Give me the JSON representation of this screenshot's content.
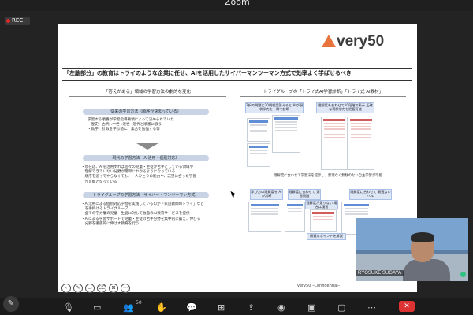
{
  "meeting": {
    "title": "Zoom",
    "rec_label": "REC"
  },
  "slide": {
    "logo_text": "very50",
    "title": "「左脳部分」の教育はトライのような企業に任せ、AIを活用したサイバーマンツーマン方式で効率よく学ばせるべき",
    "left": {
      "heading": "「答えがある」領域の学習方法の劇的な変化",
      "old_label": "従来の学習方法（順序が決まっている）",
      "old_bullets": [
        "学習する順番が学習指導要領によって決められていた",
        "・歴史：古代→中世→近世→近代と順番に扱う",
        "・数学：計数を学ぶ前に、集合を勉強する等"
      ],
      "now_label": "現代の学習方法（AI活用・個別対応）",
      "now_bullets": [
        "・現在は、AIを活用すれば個々の児童・生徒が苦手としている領域や",
        "　理解できていない分野が簡単にわかるようになっている",
        "・順序を追ってやらなくても、一人ひとりの能力や、志望に合った学習",
        "　が可能となっている"
      ],
      "try_label": "トライグループの学習方法（サイバー・マンツーマン方式）",
      "try_bullets": [
        "・AI活用による個別対応学習を実践しているのが「家庭教師のトライ」など",
        "　を手掛けるトライグループ",
        "・全ての学力層の児童・生徒に対して独自のAI教育サービスを提供",
        "・AIによる学習サポートで児童・生徒の苦手分野を集中的に鍛え、伸びる",
        "　分野を徹底的に伸ばす教育を行う"
      ]
    },
    "right": {
      "heading": "トライグループの「トライ式AI学習診断」「トライ式 AI教材」",
      "note_a": "2択の問題に20問程度答えると AIが現状学力を一瞬で診断",
      "note_b": "理解度を合わせて10段階で表示 正確な現状学力を把握可能",
      "mid_caption": "理解度に合わせて学習法を提示し、無理なく無駄のない自主学習が可能",
      "note_c": "学び方の理解度を AIが判断",
      "note_d": "理解度に合わせて 演習問題",
      "note_e": "理解度に合わせて 最適なレベル",
      "note_f": "理解度が足りない 場合は復習",
      "note_g": "最適なポイントを解説"
    },
    "footer": "very50 –Confidential–"
  },
  "slide_controls": [
    "‹",
    "✎",
    "▭",
    "CC",
    "⊠",
    "⋯"
  ],
  "video": {
    "name": "RYOSUKE SUGAYA"
  },
  "toolbar": {
    "participants_count": "50"
  }
}
